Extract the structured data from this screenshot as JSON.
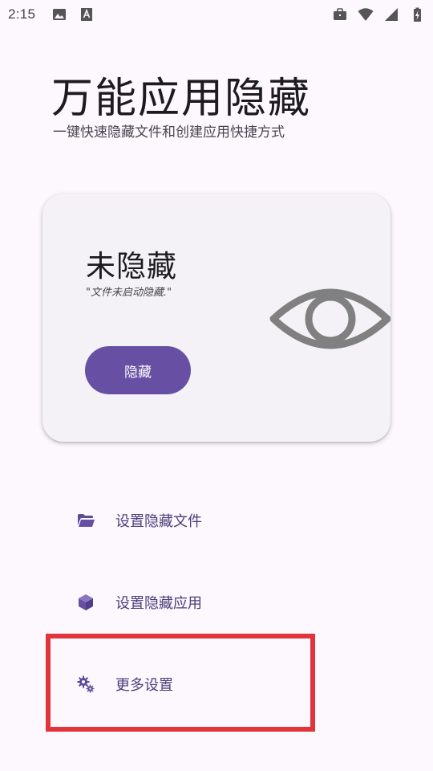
{
  "status_bar": {
    "time": "2:15"
  },
  "header": {
    "title": "万能应用隐藏",
    "subtitle": "一键快速隐藏文件和创建应用快捷方式"
  },
  "status_card": {
    "state": "未隐藏",
    "description": "\"文件未启动隐藏.\"",
    "action_label": "隐藏"
  },
  "menu": {
    "items": [
      {
        "label": "设置隐藏文件",
        "icon": "folder-open-icon"
      },
      {
        "label": "设置隐藏应用",
        "icon": "cube-icon"
      },
      {
        "label": "更多设置",
        "icon": "gears-icon"
      }
    ]
  },
  "colors": {
    "accent": "#6750a4",
    "menu_text": "#4a3f7a",
    "highlight": "#e2353b",
    "background": "#fdf7fe",
    "card": "#f4f2f6",
    "eye": "#808080"
  }
}
